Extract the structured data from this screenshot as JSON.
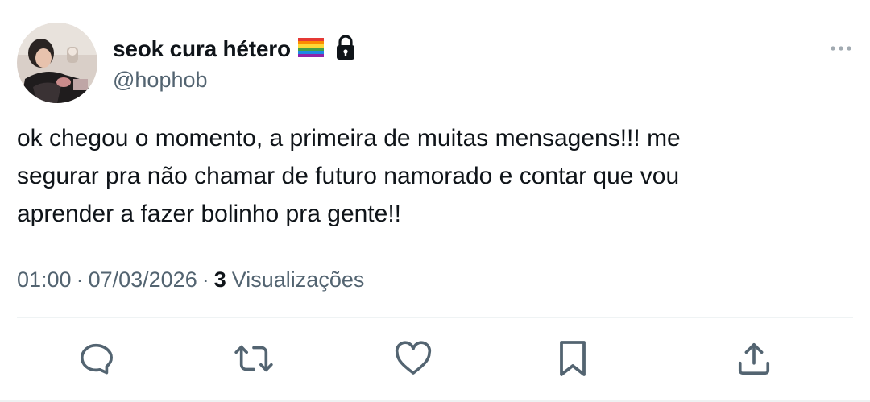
{
  "user": {
    "display_name": "seok cura hétero",
    "handle": "@hophob",
    "flag_icon": "rainbow-flag-icon",
    "lock_icon": "lock-icon",
    "avatar": "profile-photo"
  },
  "tweet": {
    "text": "ok chegou o momento, a primeira de muitas mensagens!!! me\nsegurar pra não chamar de futuro namorado e contar que vou\naprender a fazer bolinho pra gente!!",
    "time": "01:00",
    "date": "07/03/2026",
    "separator": "·",
    "views_count": "3",
    "views_label": "Visualizações"
  },
  "actions": [
    "reply-icon",
    "retweet-icon",
    "like-icon",
    "bookmark-icon",
    "share-icon"
  ],
  "colors": {
    "text": "#0f1419",
    "secondary": "#536471",
    "icon": "#536471",
    "divider": "#eff3f4"
  }
}
